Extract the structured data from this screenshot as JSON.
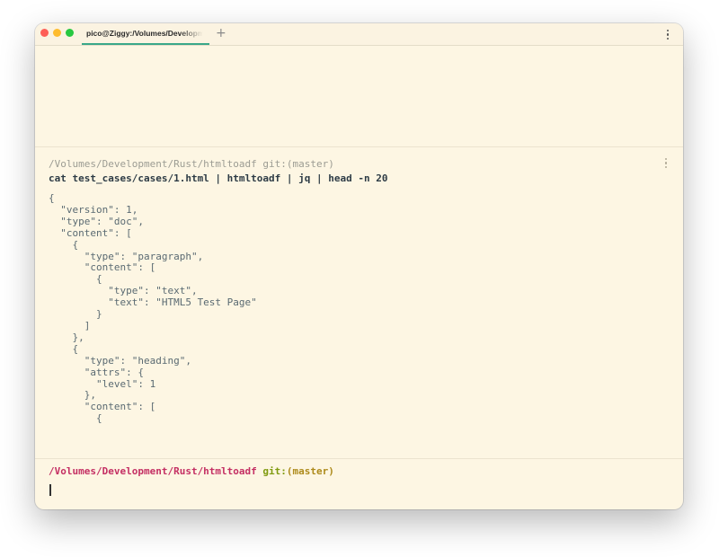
{
  "tab": {
    "title": "pico@Ziggy:/Volumes/Development/Rust/htmltoadf",
    "new_tab_label": "+"
  },
  "block": {
    "header": "/Volumes/Development/Rust/htmltoadf git:(master)",
    "command": "cat test_cases/cases/1.html | htmltoadf | jq | head -n 20",
    "output": "{\n  \"version\": 1,\n  \"type\": \"doc\",\n  \"content\": [\n    {\n      \"type\": \"paragraph\",\n      \"content\": [\n        {\n          \"type\": \"text\",\n          \"text\": \"HTML5 Test Page\"\n        }\n      ]\n    },\n    {\n      \"type\": \"heading\",\n      \"attrs\": {\n        \"level\": 1\n      },\n      \"content\": [\n        {"
  },
  "prompt": {
    "path": "/Volumes/Development/Rust/htmltoadf",
    "git_label": "git:",
    "branch": "(master)"
  },
  "colors": {
    "background": "#fdf6e3",
    "tab_accent": "#3aa889",
    "prompt_path": "#c42f63",
    "prompt_git": "#7f9a0e",
    "prompt_branch": "#ad8a1a"
  },
  "icons": {
    "window_controls": [
      "close-icon",
      "minimize-icon",
      "zoom-icon"
    ],
    "menu": "kebab-menu-icon"
  }
}
